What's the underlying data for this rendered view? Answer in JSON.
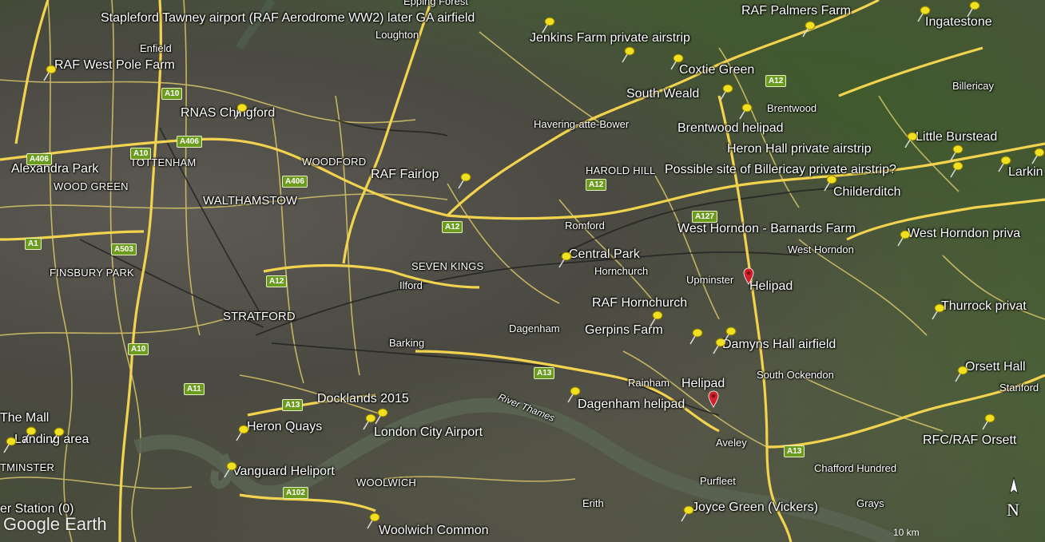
{
  "map": {
    "logo": "Google Earth",
    "scale": "10 km",
    "north": "N",
    "colors": {
      "major_road": "#f2d34f",
      "minor_road": "#e2cf72",
      "river": "#5d6a55",
      "pin": "#f0e020",
      "red_pin": "#d0202a"
    },
    "places": [
      "Epping Forest",
      "Loughton",
      "Enfield",
      "TOTTENHAM",
      "WOOD GREEN",
      "WALTHAMSTOW",
      "WOODFORD",
      "FINSBURY PARK",
      "STRATFORD",
      "SEVEN KINGS",
      "Ilford",
      "Barking",
      "Dagenham",
      "Romford",
      "HAROLD HILL",
      "Havering-atte-Bower",
      "Brentwood",
      "Billericay",
      "Hornchurch",
      "Upminster",
      "West Horndon",
      "Rainham",
      "South Ockendon",
      "Aveley",
      "Purfleet",
      "Chafford Hundred",
      "Grays",
      "Erith",
      "WOOLWICH",
      "River Thames",
      "TMINSTER",
      "Stanford"
    ],
    "pois": [
      "Stapleford Tawney airport  (RAF Aerodrome WW2) later GA airfield",
      "RAF Palmers Farm",
      "Ingatestone",
      "Jenkins Farm private airstrip",
      "RAF  West Pole Farm",
      "Coxtie Green",
      "South Weald",
      "RNAS Chingford",
      "Brentwood helipad",
      "Little Burstead",
      "Heron Hall private airstrip",
      "Alexandra Park",
      "RAF Fairlop",
      "Possible site of Billericay private airstrip?",
      "Larkin",
      "Childerditch",
      "West Horndon - Barnards Farm",
      "West Horndon priva",
      "Central Park",
      "Helipad",
      "RAF Hornchurch",
      "Thurrock privat",
      "Gerpins Farm",
      "Damyns Hall airfield",
      "Orsett Hall",
      "Helipad",
      "Dagenham helipad",
      "Docklands 2015",
      "The Mall",
      "Heron Quays",
      "London City Airport",
      "Landing area",
      "RFC/RAF Orsett",
      "Vanguard Heliport",
      "er Station (0)",
      "Joyce Green (Vickers)",
      "Woolwich Common"
    ],
    "road_shields": [
      "A10",
      "A12",
      "A10",
      "A406",
      "A406",
      "A406",
      "A1",
      "A503",
      "A12",
      "A10",
      "A12",
      "A12",
      "A127",
      "A11",
      "A13",
      "A13",
      "A102",
      "A13"
    ]
  }
}
